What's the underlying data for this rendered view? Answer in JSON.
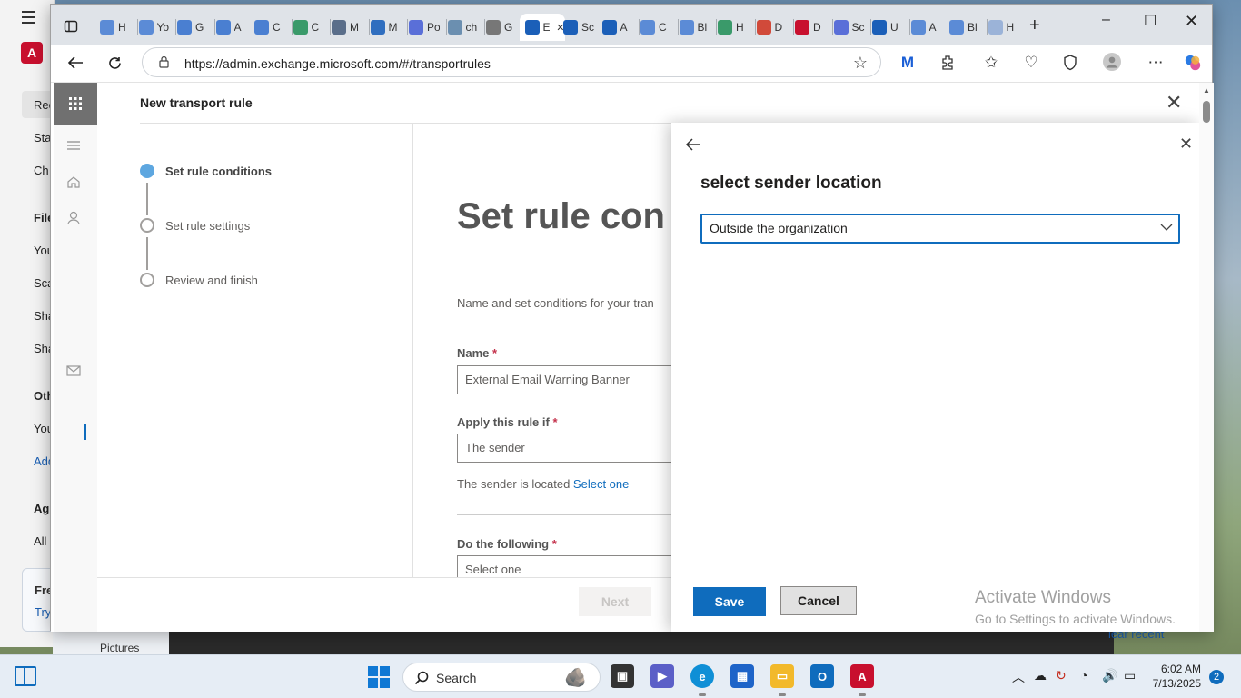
{
  "background_app": {
    "items": [
      "Rec",
      "Sta",
      "Ch",
      "File",
      "You",
      "Sca",
      "Sha",
      "Sha",
      "Oth",
      "You",
      "Add",
      "Ag",
      "All"
    ],
    "card_title": "Fre",
    "card_link": "Try",
    "pictures": "Pictures",
    "clear_recent": "lear recent"
  },
  "browser": {
    "tabs": [
      {
        "label": "H",
        "color": "#5b8bd6"
      },
      {
        "label": "Yo",
        "color": "#5b8bd6"
      },
      {
        "label": "G",
        "color": "#4a7fd1"
      },
      {
        "label": "A",
        "color": "#4a7fd1"
      },
      {
        "label": "C",
        "color": "#4a7fd1"
      },
      {
        "label": "C",
        "color": "#3a9a6a"
      },
      {
        "label": "M",
        "color": "#5a6e8a"
      },
      {
        "label": "M",
        "color": "#2f6ebf"
      },
      {
        "label": "Po",
        "color": "#5a6fd8"
      },
      {
        "label": "ch",
        "color": "#6b8fb0"
      },
      {
        "label": "G",
        "color": "#777777"
      },
      {
        "label": "E",
        "color": "#1b5fb8"
      },
      {
        "label": "Sc",
        "color": "#1b5fb8"
      },
      {
        "label": "A",
        "color": "#1b5fb8"
      },
      {
        "label": "C",
        "color": "#5b8bd6"
      },
      {
        "label": "Bl",
        "color": "#5b8bd6"
      },
      {
        "label": "H",
        "color": "#3a9a6a"
      },
      {
        "label": "D",
        "color": "#d14a3a"
      },
      {
        "label": "D",
        "color": "#c8102e"
      },
      {
        "label": "Sc",
        "color": "#5a6fd8"
      },
      {
        "label": "U",
        "color": "#1b5fb8"
      },
      {
        "label": "A",
        "color": "#5b8bd6"
      },
      {
        "label": "Bl",
        "color": "#5b8bd6"
      },
      {
        "label": "H",
        "color": "#9bb3d8"
      }
    ],
    "url": "https://admin.exchange.microsoft.com/#/transportrules"
  },
  "panel": {
    "title": "New transport rule",
    "steps": [
      {
        "label": "Set rule conditions",
        "active": true
      },
      {
        "label": "Set rule settings",
        "active": false
      },
      {
        "label": "Review and finish",
        "active": false
      }
    ],
    "heading": "Set rule con",
    "description": "Name and set conditions for your tran",
    "name_label": "Name",
    "name_required": "*",
    "name_value": "External Email Warning Banner",
    "apply_label": "Apply this rule if",
    "apply_required": "*",
    "apply_value": "The sender",
    "sender_text": "The sender is located",
    "sender_link": "Select one",
    "do_label": "Do the following",
    "do_required": "*",
    "do_value": "Select one",
    "next": "Next"
  },
  "flyout": {
    "title": "select sender location",
    "dropdown_value": "Outside the organization",
    "save": "Save",
    "cancel": "Cancel",
    "watermark_title": "Activate Windows",
    "watermark_sub": "Go to Settings to activate Windows."
  },
  "taskbar": {
    "search_placeholder": "Search",
    "time": "6:02 AM",
    "date": "7/13/2025",
    "notifications": "2"
  }
}
